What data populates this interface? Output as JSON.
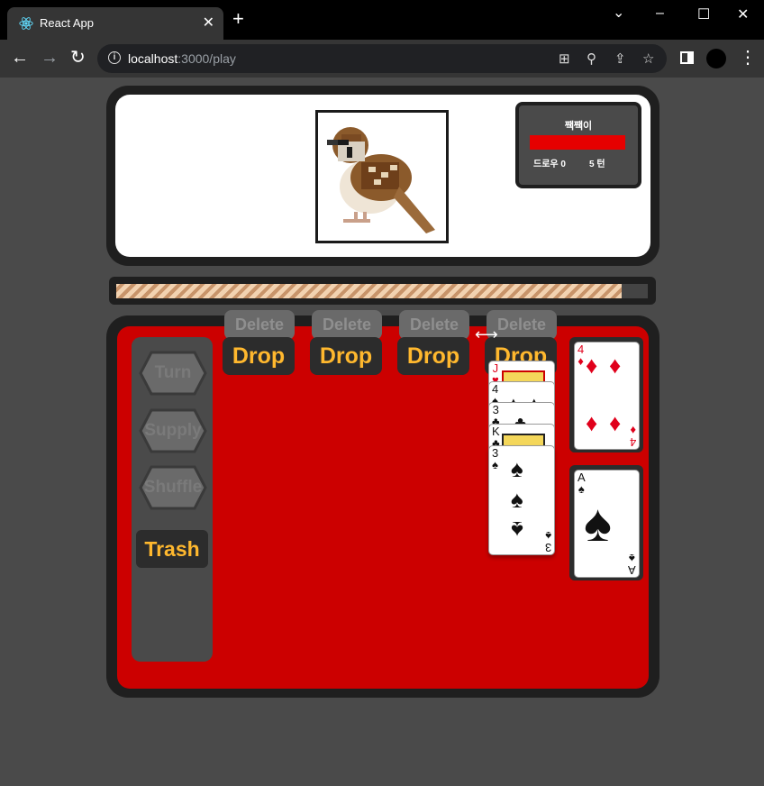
{
  "browser": {
    "tab_title": "React App",
    "url_host": "localhost",
    "url_path": ":3000/play"
  },
  "status": {
    "name": "짹짹이",
    "hp_fraction": 1.0,
    "draw_label": "드로우 0",
    "turn_label": "5 턴",
    "hp_color": "#e60000"
  },
  "progress": {
    "fraction": 0.95
  },
  "sidebar": {
    "turn_label": "Turn",
    "supply_label": "Supply",
    "shuffle_label": "Shuffle",
    "trash_label": "Trash"
  },
  "slots": [
    {
      "delete_label": "Delete",
      "drop_label": "Drop"
    },
    {
      "delete_label": "Delete",
      "drop_label": "Drop"
    },
    {
      "delete_label": "Delete",
      "drop_label": "Drop"
    },
    {
      "delete_label": "Delete",
      "drop_label": "Drop"
    }
  ],
  "hand_stack": [
    {
      "rank": "J",
      "suit": "♥"
    },
    {
      "rank": "4",
      "suit": "♠"
    },
    {
      "rank": "3",
      "suit": "♣"
    },
    {
      "rank": "K",
      "suit": "♣"
    },
    {
      "rank": "3",
      "suit": "♠"
    }
  ],
  "deck_cards": [
    {
      "rank": "4",
      "suit": "♦"
    },
    {
      "rank": "A",
      "suit": "♠"
    }
  ],
  "colors": {
    "board": "#cc0000",
    "accent": "#ffb82e",
    "frame": "#1f1f1f"
  }
}
